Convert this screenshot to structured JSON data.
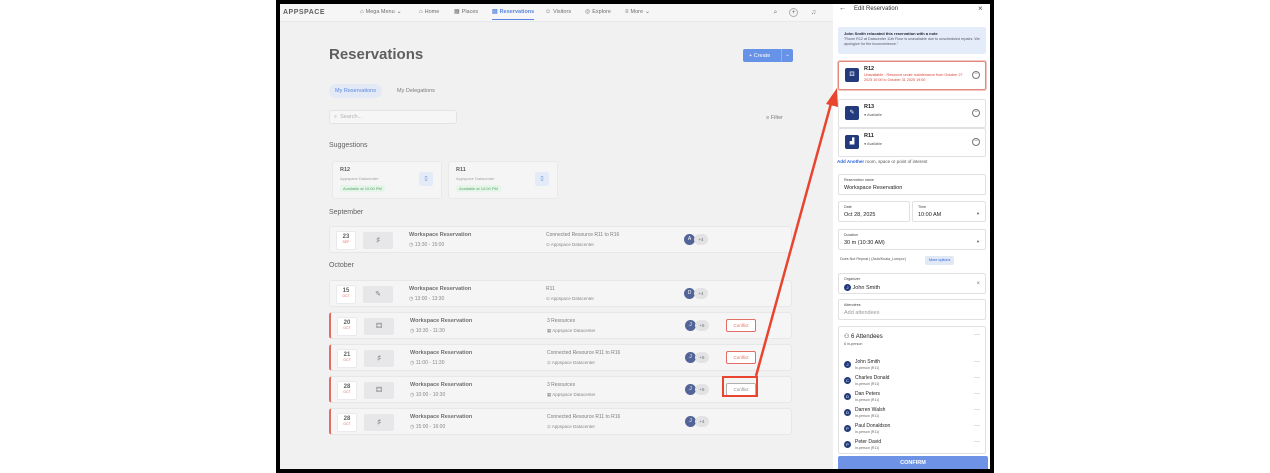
{
  "topnav": {
    "logo": "APPSPACE",
    "items": [
      {
        "label": "Mega Menu",
        "icon": "grid-icon",
        "caret": true
      },
      {
        "label": "Home",
        "icon": "home-icon"
      },
      {
        "label": "Places",
        "icon": "building-icon"
      },
      {
        "label": "Reservations",
        "icon": "calendar-icon",
        "active": true
      },
      {
        "label": "Visitors",
        "icon": "visitors-icon"
      },
      {
        "label": "Explore",
        "icon": "compass-icon"
      },
      {
        "label": "More",
        "icon": "menu-icon",
        "caret": true
      }
    ]
  },
  "page": {
    "title": "Reservations",
    "create_label": "+ Create",
    "tabs": [
      "My Reservations",
      "My Delegations"
    ],
    "search_placeholder": "Search...",
    "filter_label": "Filter",
    "suggestions_label": "Suggestions"
  },
  "suggestions": [
    {
      "name": "R12",
      "site": "Appspace Datacenter",
      "avail": "Available at 10:00 PM"
    },
    {
      "name": "R11",
      "site": "Appspace Datacenter",
      "avail": "Available at 10:00 PM"
    }
  ],
  "months": [
    "September",
    "October"
  ],
  "reservations": [
    {
      "day": "23",
      "mon": "SEP",
      "icon": "♯",
      "name": "Workspace Reservation",
      "time": "13:30 - 15:00",
      "res": "Connected Resource R11 to R16",
      "loc": "Appspace Datacenter",
      "av": "A",
      "plus": "+4",
      "conflict": false
    },
    {
      "day": "15",
      "mon": "OCT",
      "icon": "✎",
      "name": "Workspace Reservation",
      "time": "13:00 - 13:30",
      "res": "R11",
      "loc": "Appspace Datacenter",
      "av": "D",
      "plus": "+4",
      "conflict": false
    },
    {
      "day": "20",
      "mon": "OCT",
      "icon": "⚃",
      "name": "Workspace Reservation",
      "time": "10:30 - 11:30",
      "res": "3 Resources",
      "loc": "Appspace Datacenter",
      "av": "J",
      "plus": "+5",
      "conflict": true
    },
    {
      "day": "21",
      "mon": "OCT",
      "icon": "♯",
      "name": "Workspace Reservation",
      "time": "11:00 - 11:30",
      "res": "Connected Resource R11 to R16",
      "loc": "Appspace Datacenter",
      "av": "J",
      "plus": "+5",
      "conflict": true
    },
    {
      "day": "28",
      "mon": "OCT",
      "icon": "⚃",
      "name": "Workspace Reservation",
      "time": "10:00 - 10:30",
      "res": "3 Resources",
      "loc": "Appspace Datacenter",
      "av": "J",
      "plus": "+5",
      "conflict": true
    },
    {
      "day": "28",
      "mon": "OCT",
      "icon": "♯",
      "name": "Workspace Reservation",
      "time": "15:00 - 16:00",
      "res": "Connected Resource R11 to R16",
      "loc": "Appspace Datacenter",
      "av": "J",
      "plus": "+4",
      "conflict": false
    }
  ],
  "conflict_label": "Conflict",
  "panel": {
    "title": "Edit Reservation",
    "note_title": "John Smith relocated this reservation with a note",
    "note_body": "\"Room R12 at Datacenter 11th Floor is unavailable due to unscheduled repairs. We apologize for the inconvenience.\"",
    "resources": [
      {
        "name": "R12",
        "status": "Unavailable - Resource under maintenance from October 27 2025 10:00 to October 31 2025 19:00",
        "bad": true
      },
      {
        "name": "R13",
        "status": "● Available",
        "bad": false
      },
      {
        "name": "R11",
        "status": "● Available",
        "bad": false
      }
    ],
    "add_another": "Add Another",
    "add_another_rest": " room, space or point of interest",
    "res_name_label": "Reservation name",
    "res_name_value": "Workspace Reservation",
    "date_label": "Date",
    "date_value": "Oct 28, 2025",
    "time_label": "Time",
    "time_value": "10:00 AM",
    "duration_label": "Duration",
    "duration_value": "30 m (10:30 AM)",
    "repeat_text": "Does Not Repeat  |  (Asia/Kuala_Lumpur)",
    "more_options": "More options",
    "organizer_label": "Organizer",
    "organizer_value": "John Smith",
    "attendees_label": "Attendees",
    "attendees_placeholder": "Add attendees",
    "att_count": "6 Attendees",
    "att_sub": "6 in-person",
    "people": [
      {
        "name": "John Smith",
        "role": "In-person (R11)",
        "init": "J"
      },
      {
        "name": "Charles Donald",
        "role": "In-person (R11)",
        "init": "C"
      },
      {
        "name": "Dan Peters",
        "role": "In-person (R11)",
        "init": "D"
      },
      {
        "name": "Darren Walsh",
        "role": "In-person (R11)",
        "init": "D"
      },
      {
        "name": "Paul Donaldson",
        "role": "In-person (R11)",
        "init": "P"
      },
      {
        "name": "Peter David",
        "role": "In-person (R11)",
        "init": "P"
      }
    ],
    "confirm": "CONFIRM"
  },
  "colors": {
    "accent": "#3b74e0",
    "conflict": "#d9463a",
    "annotation": "#e8442e",
    "navy": "#233a7c"
  }
}
